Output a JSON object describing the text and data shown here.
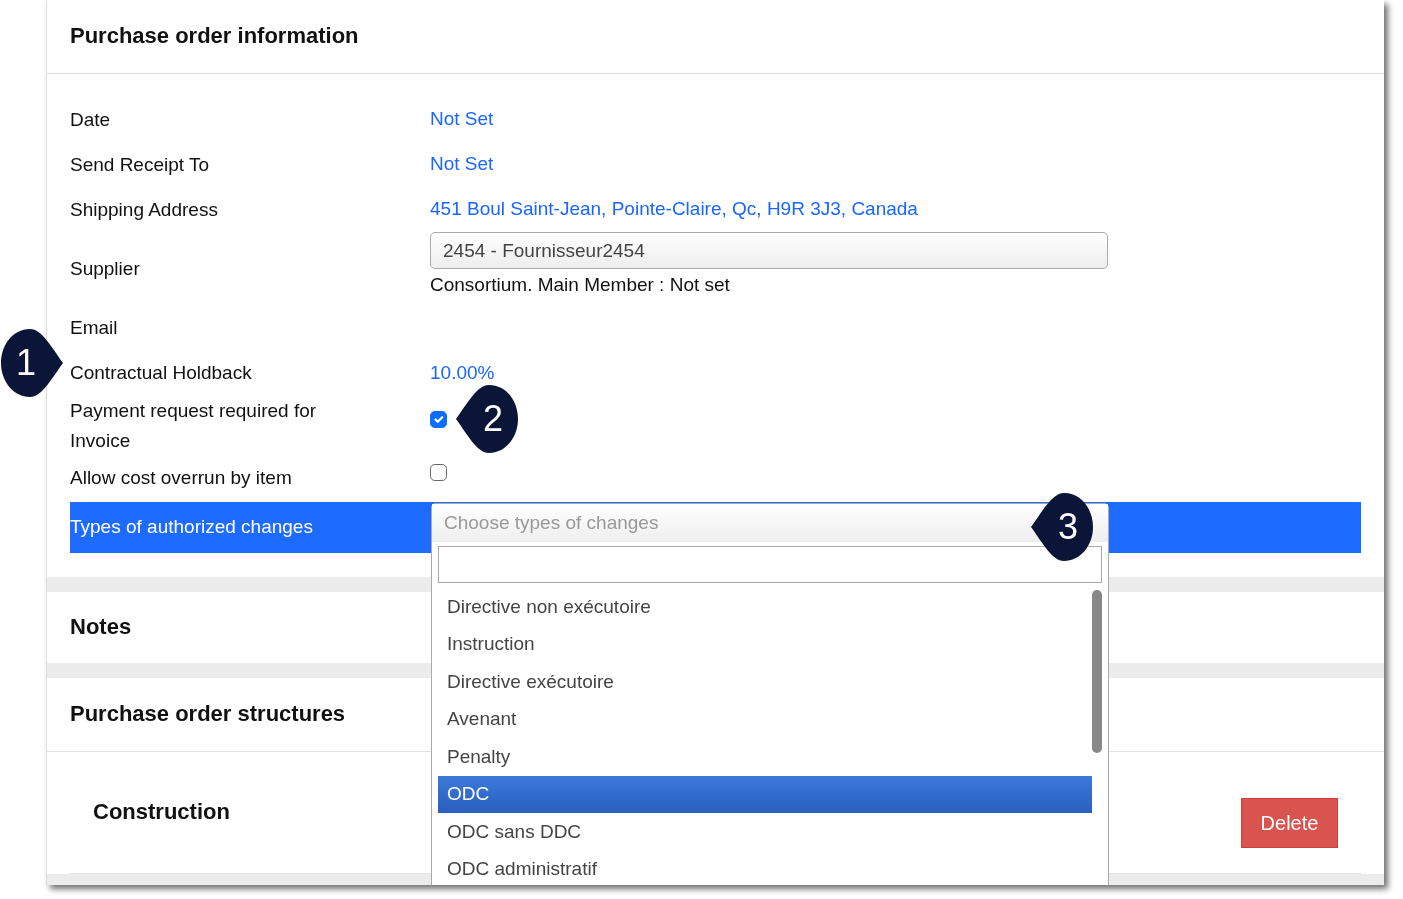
{
  "sections": [
    {
      "title": "Purchase order information",
      "fields": [
        {
          "kind": "link",
          "label": "Date",
          "value": "Not Set"
        },
        {
          "kind": "link",
          "label": "Send Receipt To",
          "value": "Not Set"
        },
        {
          "kind": "link",
          "label": "Shipping Address",
          "value": "451 Boul Saint-Jean, Pointe-Claire, Qc, H9R 3J3, Canada"
        },
        {
          "kind": "select",
          "label": "Supplier",
          "value": "2454 - Fournisseur2454",
          "note": "Consortium. Main Member : Not set"
        },
        {
          "kind": "empty",
          "label": "Email"
        },
        {
          "kind": "link",
          "label": "Contractual Holdback",
          "value": "10.00%"
        },
        {
          "kind": "checkbox",
          "label": "Payment request required for Invoice",
          "checked": true
        },
        {
          "kind": "checkbox",
          "label": "Allow cost overrun by item",
          "checked": false
        },
        {
          "kind": "multiselect",
          "label": "Types of authorized changes",
          "highlighted": true
        }
      ]
    },
    {
      "title": "Notes"
    },
    {
      "title": "Purchase order structures",
      "subsections": [
        {
          "title": "Construction",
          "button": "Delete"
        }
      ]
    }
  ],
  "dropdown": {
    "placeholder": "Choose types of changes",
    "options": [
      {
        "label": "Directive non exécutoire",
        "selected": false
      },
      {
        "label": "Instruction",
        "selected": false
      },
      {
        "label": "Directive exécutoire",
        "selected": false
      },
      {
        "label": "Avenant",
        "selected": false
      },
      {
        "label": "Penalty",
        "selected": false
      },
      {
        "label": "ODC",
        "selected": true
      },
      {
        "label": "ODC sans DDC",
        "selected": false
      },
      {
        "label": "ODC administratif",
        "selected": false
      }
    ]
  },
  "callouts": [
    {
      "number": "1",
      "kind": "right"
    },
    {
      "number": "2",
      "kind": "left"
    },
    {
      "number": "3",
      "kind": "left"
    }
  ]
}
